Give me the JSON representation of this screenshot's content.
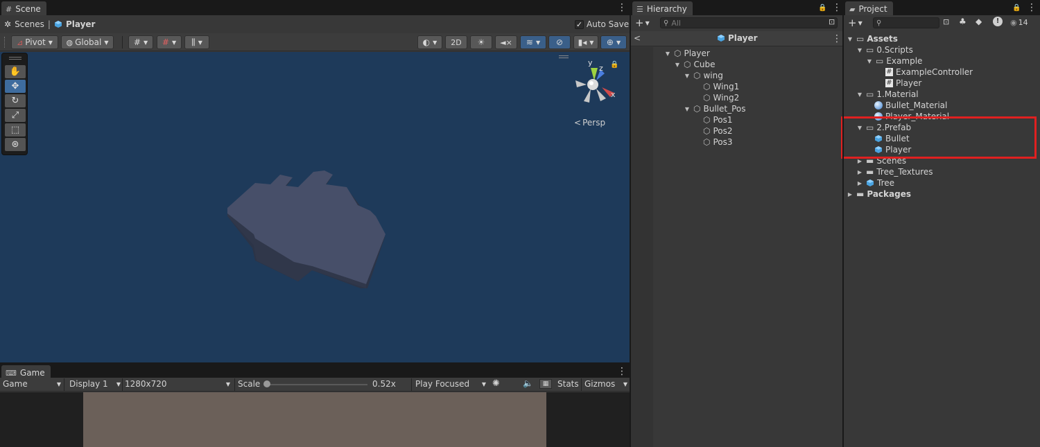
{
  "scene_panel": {
    "tab_label": "Scene",
    "breadcrumb_root": "Scenes",
    "breadcrumb_current": "Player",
    "auto_save_label": "Auto Save",
    "auto_save_checked": true,
    "pivot_label": "Pivot",
    "global_label": "Global",
    "mode_2d_label": "2D",
    "persp_label": "Persp",
    "gizmo_axes": {
      "y": "y",
      "z": "z",
      "x": "x"
    },
    "background_color": "#1e3a5a"
  },
  "game_panel": {
    "tab_label": "Game",
    "mode_label": "Game",
    "display_label": "Display 1",
    "resolution_label": "1280x720",
    "scale_label": "Scale",
    "scale_value": "0.52x",
    "scale_fraction": 0.03,
    "play_focused_label": "Play Focused",
    "stats_label": "Stats",
    "gizmos_label": "Gizmos",
    "viewport_color": "#6b6059"
  },
  "hierarchy_panel": {
    "tab_label": "Hierarchy",
    "search_placeholder": "All",
    "prefab_title": "Player",
    "items": [
      {
        "label": "Player"
      },
      {
        "label": "Cube"
      },
      {
        "label": "wing"
      },
      {
        "label": "Wing1"
      },
      {
        "label": "Wing2"
      },
      {
        "label": "Bullet_Pos"
      },
      {
        "label": "Pos1"
      },
      {
        "label": "Pos2"
      },
      {
        "label": "Pos3"
      }
    ]
  },
  "project_panel": {
    "tab_label": "Project",
    "hidden_count": "14",
    "items": [
      {
        "label": "Assets"
      },
      {
        "label": "0.Scripts"
      },
      {
        "label": "Example"
      },
      {
        "label": "ExampleController"
      },
      {
        "label": "Player"
      },
      {
        "label": "1.Material"
      },
      {
        "label": "Bullet_Material"
      },
      {
        "label": "Player_Material"
      },
      {
        "label": "2.Prefab"
      },
      {
        "label": "Bullet"
      },
      {
        "label": "Player"
      },
      {
        "label": "Scenes"
      },
      {
        "label": "Tree_Textures"
      },
      {
        "label": "Tree"
      },
      {
        "label": "Packages"
      }
    ],
    "highlight_color": "#e02020"
  },
  "icons": {
    "scene_tab": "grid-icon",
    "game_tab": "gamepad-icon",
    "hierarchy_tab": "list-icon",
    "project_tab": "folder-icon",
    "prefab": "cube-icon",
    "script": "hash-icon",
    "material": "sphere-icon",
    "folder": "folder-icon"
  }
}
